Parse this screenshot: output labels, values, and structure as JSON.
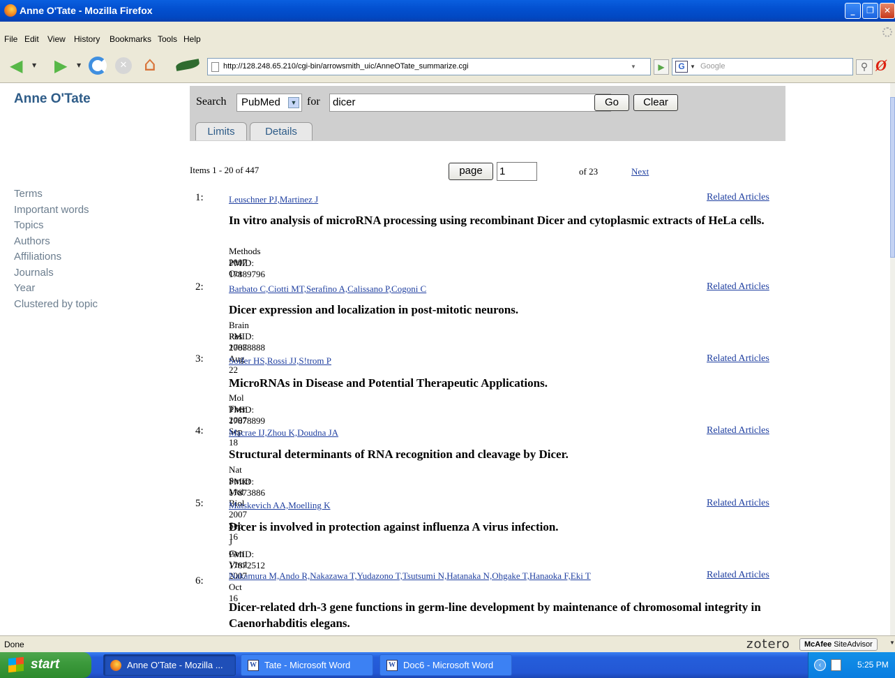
{
  "window": {
    "title": "Anne O'Tate - Mozilla Firefox"
  },
  "menu": [
    "File",
    "Edit",
    "View",
    "History",
    "Bookmarks",
    "Tools",
    "Help"
  ],
  "address": {
    "url": "http://128.248.65.210/cgi-bin/arrowsmith_uic/AnneOTate_summarize.cgi"
  },
  "google_search": {
    "placeholder": "Google"
  },
  "brand": "Anne O'Tate",
  "sidebar": {
    "items": [
      "Terms",
      "Important words",
      "Topics",
      "Authors",
      "Affiliations",
      "Journals",
      "Year",
      "Clustered by topic"
    ]
  },
  "search": {
    "label_search": "Search",
    "database": "PubMed",
    "label_for": "for",
    "query": "dicer",
    "go": "Go",
    "clear": "Clear",
    "tabs": [
      "Limits",
      "Details"
    ]
  },
  "pager": {
    "items": "Items 1 - 20 of 447",
    "page_button": "page",
    "page_value": "1",
    "of": "of 23",
    "next": "Next"
  },
  "results": [
    {
      "num": "1:",
      "authors": "Leuschner PJ,Martinez J",
      "related": "Related Articles",
      "title": "In vitro analysis of microRNA processing using recombinant Dicer and cytoplasmic extracts of HeLa cells.",
      "journal": "Methods 2007 Oct",
      "pmid": "PMID: 17889796"
    },
    {
      "num": "2:",
      "authors": "Barbato C,Ciotti MT,Serafino A,Calissano P,Cogoni C",
      "related": "Related Articles",
      "title": "Dicer expression and localization in post-mitotic neurons.",
      "journal": "Brain Res 2007 Aug 22",
      "pmid": "PMID: 17888888"
    },
    {
      "num": "3:",
      "authors": "Soifer HS,Rossi JJ,S!trom P",
      "related": "Related Articles",
      "title": "MicroRNAs in Disease and Potential Therapeutic Applications.",
      "journal": "Mol Ther 2007 Sep 18",
      "pmid": "PMID: 17878899"
    },
    {
      "num": "4:",
      "authors": "Macrae IJ,Zhou K,Doudna JA",
      "related": "Related Articles",
      "title": "Structural determinants of RNA recognition and cleavage by Dicer.",
      "journal": "Nat Struct Mol Biol 2007 Sep 16",
      "pmid": "PMID: 17873886"
    },
    {
      "num": "5:",
      "authors": "Matskevich AA,Moelling K",
      "related": "Related Articles",
      "title": "Dicer is involved in protection against influenza A virus infection.",
      "journal": "J Gen Virol 2007 Oct 16",
      "pmid": "PMID: 17872512"
    },
    {
      "num": "6:",
      "authors": "Nakamura M,Ando R,Nakazawa T,Yudazono T,Tsutsumi N,Hatanaka N,Ohgake T,Hanaoka F,Eki T",
      "related": "Related Articles",
      "title": "Dicer-related drh-3 gene functions in germ-line development by maintenance of chromosomal integrity in Caenorhabditis elegans.",
      "journal": "",
      "pmid": ""
    }
  ],
  "status": {
    "text": "Done",
    "zotero": "zotero",
    "mcafee_brand": "McAfee",
    "mcafee_product": "SiteAdvisor"
  },
  "taskbar": {
    "start": "start",
    "tasks": [
      "Anne O'Tate - Mozilla ...",
      "Tate - Microsoft Word",
      "Doc6 - Microsoft Word"
    ],
    "clock": "5:25 PM"
  },
  "colors": {
    "titlebar": "#0350d0",
    "brand_blue": "#2e5c88",
    "link": "#1f3fa0",
    "panel": "#cfcfcf"
  }
}
